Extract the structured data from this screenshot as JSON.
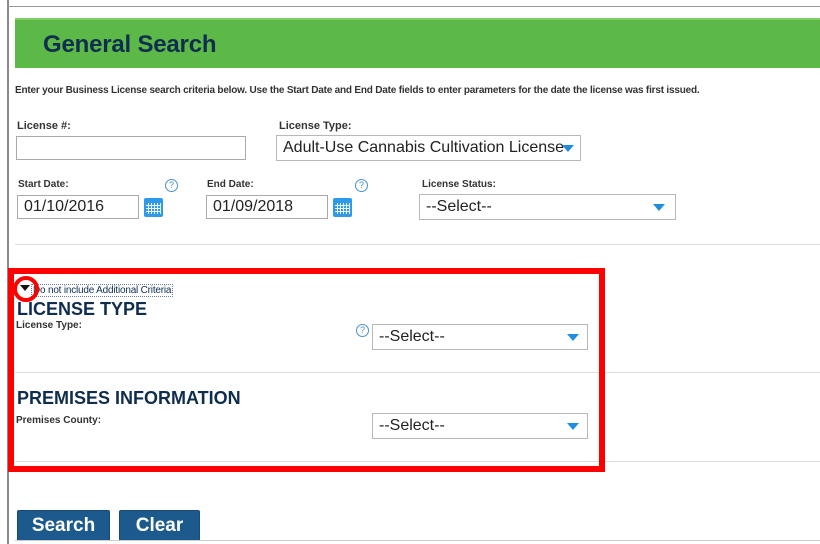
{
  "header": {
    "title": "General Search"
  },
  "intro_text": "Enter your Business License search criteria below.  Use the Start Date and End Date fields to enter parameters for the date the license was first issued.",
  "form": {
    "license_number": {
      "label": "License #:",
      "value": ""
    },
    "license_type": {
      "label": "License Type:",
      "value": "Adult-Use Cannabis Cultivation License"
    },
    "start_date": {
      "label": "Start Date:",
      "value": "01/10/2016"
    },
    "end_date": {
      "label": "End Date:",
      "value": "01/09/2018"
    },
    "license_status": {
      "label": "License Status:",
      "value": "--Select--"
    }
  },
  "additional_criteria": {
    "toggle_label": "Do not include Additional Criteria",
    "license_type_section": {
      "title": "LICENSE TYPE",
      "field_label": "License Type:",
      "value": "--Select--"
    },
    "premises_section": {
      "title": "PREMISES INFORMATION",
      "field_label": "Premises County:",
      "value": "--Select--"
    }
  },
  "buttons": {
    "search": "Search",
    "clear": "Clear"
  },
  "icons": {
    "help_glyph": "?",
    "help": "help-icon",
    "calendar": "calendar-icon",
    "dropdown": "chevron-down-icon"
  },
  "colors": {
    "header_green": "#5cb947",
    "title_navy": "#0f2d4f",
    "button_blue": "#1c5a8e",
    "accent_blue": "#1f8ee0",
    "annotation_red": "#ff0000"
  }
}
